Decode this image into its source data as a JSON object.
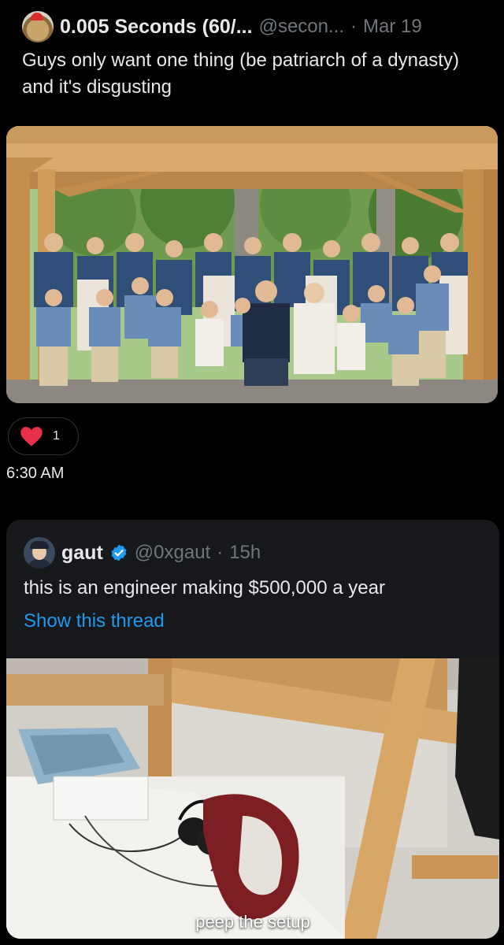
{
  "tweet1": {
    "display_name": "0.005 Seconds (60/...",
    "handle": "@secon...",
    "separator": "·",
    "date": "Mar 19",
    "text": "Guys only want one thing (be patriarch of a dynasty) and it's disgusting",
    "like_count": "1",
    "timestamp": "6:30 AM"
  },
  "tweet2": {
    "display_name": "gaut",
    "handle": "@0xgaut",
    "separator": "·",
    "time": "15h",
    "text": "this is an engineer making $500,000 a year",
    "show_thread": "Show this thread",
    "media_caption": "peep the setup"
  },
  "colors": {
    "background": "#000000",
    "card": "#16181c",
    "text": "#e7e9ea",
    "muted": "#71767b",
    "link": "#1d9bf0",
    "like": "#f91880",
    "verified": "#1d9bf0"
  },
  "icons": {
    "like": "heart-icon",
    "verified": "verified-badge-icon"
  }
}
